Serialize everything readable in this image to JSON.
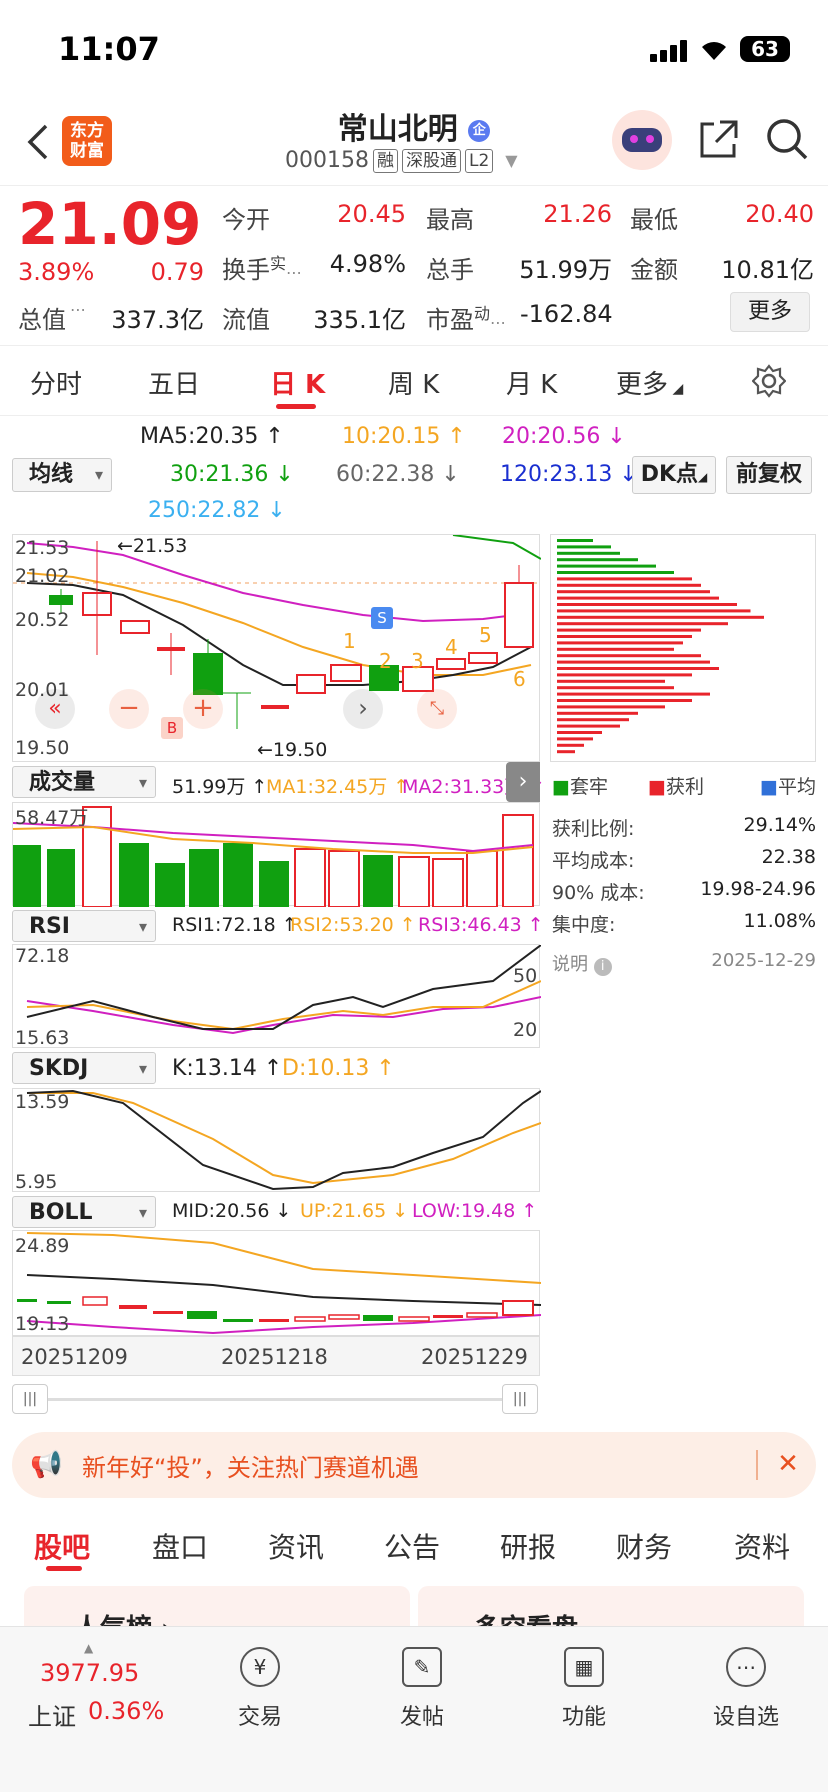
{
  "status": {
    "time": "11:07",
    "battery": "63"
  },
  "header": {
    "logo_line1": "东方",
    "logo_line2": "财富",
    "name": "常山北明",
    "badge": "企",
    "code": "000158",
    "tags": [
      "融",
      "深股通",
      "L2"
    ]
  },
  "quote": {
    "price": "21.09",
    "pct": "3.89%",
    "chg": "0.79",
    "open_label": "今开",
    "open": "20.45",
    "high_label": "最高",
    "high": "21.26",
    "low_label": "最低",
    "low": "20.40",
    "turnover_label": "换手",
    "turnover_sup": "实",
    "turnover": "4.98%",
    "volume_label": "总手",
    "volume": "51.99万",
    "amount_label": "金额",
    "amount": "10.81亿",
    "mcap_label": "总值",
    "mcap": "337.3亿",
    "float_label": "流值",
    "float": "335.1亿",
    "pe_label": "市盈",
    "pe_sup": "动",
    "pe": "-162.84",
    "more": "更多"
  },
  "tabs": [
    "分时",
    "五日",
    "日 K",
    "周 K",
    "月 K",
    "更多"
  ],
  "active_tab": 2,
  "ma": {
    "selector": "均线",
    "ma5": "MA5:20.35 ↑",
    "ma10": "10:20.15 ↑",
    "ma20": "20:20.56 ↓",
    "ma30": "30:21.36 ↓",
    "ma60": "60:22.38 ↓",
    "ma120": "120:23.13 ↓",
    "ma250": "250:22.82 ↓",
    "dk": "DK点",
    "fq": "前复权"
  },
  "kline": {
    "y_labels": [
      "21.53",
      "21.02",
      "20.52",
      "20.01",
      "19.50"
    ],
    "hi_label": "←21.53",
    "lo_label": "←19.50",
    "markers": [
      "1",
      "2",
      "3",
      "4",
      "5",
      "6"
    ],
    "b": "B",
    "s": "S"
  },
  "volume": {
    "selector": "成交量",
    "v": "51.99万 ↑",
    "ma1": "MA1:32.45万 ↑",
    "ma2": "MA2:31.33万 ↑",
    "max": "58.47万"
  },
  "rsi": {
    "selector": "RSI",
    "r1": "RSI1:72.18 ↑",
    "r2": "RSI2:53.20 ↑",
    "r3": "RSI3:46.43 ↑",
    "top": "72.18",
    "bot": "15.63",
    "l50": "50",
    "l20": "20"
  },
  "skdj": {
    "selector": "SKDJ",
    "k": "K:13.14 ↑",
    "d": "D:10.13 ↑",
    "top": "13.59",
    "bot": "5.95"
  },
  "boll": {
    "selector": "BOLL",
    "mid": "MID:20.56 ↓",
    "up": "UP:21.65 ↓",
    "low": "LOW:19.48 ↑",
    "top": "24.89",
    "bot": "19.13"
  },
  "dates": [
    "20251209",
    "20251218",
    "20251229"
  ],
  "chips": {
    "legend": [
      "套牢",
      "获利",
      "平均"
    ],
    "rows": [
      {
        "label": "获利比例:",
        "value": "29.14%"
      },
      {
        "label": "平均成本:",
        "value": "22.38"
      },
      {
        "label": "90% 成本:",
        "value": "19.98-24.96"
      },
      {
        "label": "集中度:",
        "value": "11.08%"
      }
    ],
    "note": "说明",
    "date": "2025-12-29"
  },
  "banner": "新年好“投”，关注热门赛道机遇",
  "bottom_tabs": [
    "股吧",
    "盘口",
    "资讯",
    "公告",
    "研报",
    "财务",
    "资料"
  ],
  "below": [
    "人气榜 ›",
    "多空看盘"
  ],
  "footer": {
    "index_value": "3977.95",
    "index_name": "上证",
    "index_pct": "0.36%",
    "items": [
      "交易",
      "发帖",
      "功能",
      "设自选"
    ]
  },
  "colors": {
    "up": "#e8242b",
    "down": "#10a010",
    "ma5": "#222222",
    "ma10": "#f4a622",
    "ma20": "#d020c0"
  }
}
